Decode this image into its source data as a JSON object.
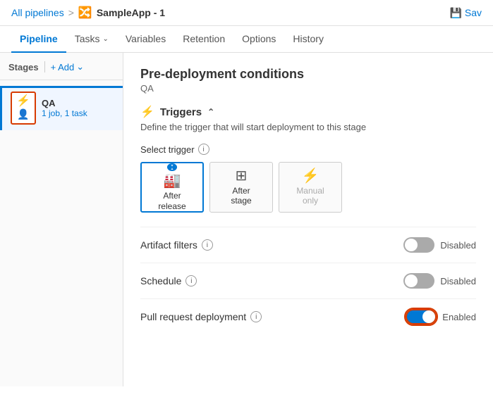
{
  "topbar": {
    "breadcrumb_link": "All pipelines",
    "separator": ">",
    "pipeline_name": "SampleApp - 1",
    "save_label": "Sav"
  },
  "nav": {
    "tabs": [
      {
        "id": "pipeline",
        "label": "Pipeline",
        "active": true,
        "has_chevron": false
      },
      {
        "id": "tasks",
        "label": "Tasks",
        "active": false,
        "has_chevron": true
      },
      {
        "id": "variables",
        "label": "Variables",
        "active": false,
        "has_chevron": false
      },
      {
        "id": "retention",
        "label": "Retention",
        "active": false,
        "has_chevron": false
      },
      {
        "id": "options",
        "label": "Options",
        "active": false,
        "has_chevron": false
      },
      {
        "id": "history",
        "label": "History",
        "active": false,
        "has_chevron": false
      }
    ]
  },
  "sidebar": {
    "stages_label": "Stages",
    "add_label": "+ Add",
    "stage": {
      "name": "QA",
      "meta": "1 job, 1 task"
    }
  },
  "panel": {
    "title": "Pre-deployment conditions",
    "subtitle": "QA",
    "triggers_section": {
      "label": "Triggers",
      "description": "Define the trigger that will start deployment to this stage",
      "select_trigger_label": "Select trigger",
      "options": [
        {
          "id": "after-release",
          "icon": "🏭",
          "label": "After\nrelease",
          "selected": true,
          "disabled": false
        },
        {
          "id": "after-stage",
          "icon": "⊞",
          "label": "After\nstage",
          "selected": false,
          "disabled": false
        },
        {
          "id": "manual-only",
          "icon": "⚡",
          "label": "Manual\nonly",
          "selected": false,
          "disabled": true
        }
      ]
    },
    "artifact_filters": {
      "label": "Artifact filters",
      "state": "off",
      "state_label": "Disabled"
    },
    "schedule": {
      "label": "Schedule",
      "state": "off",
      "state_label": "Disabled"
    },
    "pull_request": {
      "label": "Pull request deployment",
      "state": "on",
      "state_label": "Enabled"
    }
  }
}
